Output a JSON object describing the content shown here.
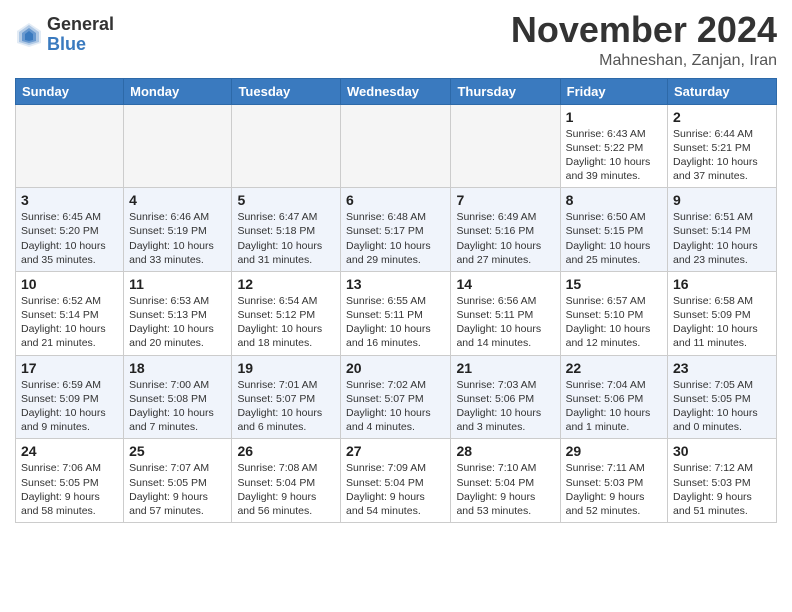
{
  "header": {
    "logo_general": "General",
    "logo_blue": "Blue",
    "month_title": "November 2024",
    "location": "Mahneshan, Zanjan, Iran"
  },
  "weekdays": [
    "Sunday",
    "Monday",
    "Tuesday",
    "Wednesday",
    "Thursday",
    "Friday",
    "Saturday"
  ],
  "weeks": [
    [
      {
        "day": "",
        "info": ""
      },
      {
        "day": "",
        "info": ""
      },
      {
        "day": "",
        "info": ""
      },
      {
        "day": "",
        "info": ""
      },
      {
        "day": "",
        "info": ""
      },
      {
        "day": "1",
        "info": "Sunrise: 6:43 AM\nSunset: 5:22 PM\nDaylight: 10 hours\nand 39 minutes."
      },
      {
        "day": "2",
        "info": "Sunrise: 6:44 AM\nSunset: 5:21 PM\nDaylight: 10 hours\nand 37 minutes."
      }
    ],
    [
      {
        "day": "3",
        "info": "Sunrise: 6:45 AM\nSunset: 5:20 PM\nDaylight: 10 hours\nand 35 minutes."
      },
      {
        "day": "4",
        "info": "Sunrise: 6:46 AM\nSunset: 5:19 PM\nDaylight: 10 hours\nand 33 minutes."
      },
      {
        "day": "5",
        "info": "Sunrise: 6:47 AM\nSunset: 5:18 PM\nDaylight: 10 hours\nand 31 minutes."
      },
      {
        "day": "6",
        "info": "Sunrise: 6:48 AM\nSunset: 5:17 PM\nDaylight: 10 hours\nand 29 minutes."
      },
      {
        "day": "7",
        "info": "Sunrise: 6:49 AM\nSunset: 5:16 PM\nDaylight: 10 hours\nand 27 minutes."
      },
      {
        "day": "8",
        "info": "Sunrise: 6:50 AM\nSunset: 5:15 PM\nDaylight: 10 hours\nand 25 minutes."
      },
      {
        "day": "9",
        "info": "Sunrise: 6:51 AM\nSunset: 5:14 PM\nDaylight: 10 hours\nand 23 minutes."
      }
    ],
    [
      {
        "day": "10",
        "info": "Sunrise: 6:52 AM\nSunset: 5:14 PM\nDaylight: 10 hours\nand 21 minutes."
      },
      {
        "day": "11",
        "info": "Sunrise: 6:53 AM\nSunset: 5:13 PM\nDaylight: 10 hours\nand 20 minutes."
      },
      {
        "day": "12",
        "info": "Sunrise: 6:54 AM\nSunset: 5:12 PM\nDaylight: 10 hours\nand 18 minutes."
      },
      {
        "day": "13",
        "info": "Sunrise: 6:55 AM\nSunset: 5:11 PM\nDaylight: 10 hours\nand 16 minutes."
      },
      {
        "day": "14",
        "info": "Sunrise: 6:56 AM\nSunset: 5:11 PM\nDaylight: 10 hours\nand 14 minutes."
      },
      {
        "day": "15",
        "info": "Sunrise: 6:57 AM\nSunset: 5:10 PM\nDaylight: 10 hours\nand 12 minutes."
      },
      {
        "day": "16",
        "info": "Sunrise: 6:58 AM\nSunset: 5:09 PM\nDaylight: 10 hours\nand 11 minutes."
      }
    ],
    [
      {
        "day": "17",
        "info": "Sunrise: 6:59 AM\nSunset: 5:09 PM\nDaylight: 10 hours\nand 9 minutes."
      },
      {
        "day": "18",
        "info": "Sunrise: 7:00 AM\nSunset: 5:08 PM\nDaylight: 10 hours\nand 7 minutes."
      },
      {
        "day": "19",
        "info": "Sunrise: 7:01 AM\nSunset: 5:07 PM\nDaylight: 10 hours\nand 6 minutes."
      },
      {
        "day": "20",
        "info": "Sunrise: 7:02 AM\nSunset: 5:07 PM\nDaylight: 10 hours\nand 4 minutes."
      },
      {
        "day": "21",
        "info": "Sunrise: 7:03 AM\nSunset: 5:06 PM\nDaylight: 10 hours\nand 3 minutes."
      },
      {
        "day": "22",
        "info": "Sunrise: 7:04 AM\nSunset: 5:06 PM\nDaylight: 10 hours\nand 1 minute."
      },
      {
        "day": "23",
        "info": "Sunrise: 7:05 AM\nSunset: 5:05 PM\nDaylight: 10 hours\nand 0 minutes."
      }
    ],
    [
      {
        "day": "24",
        "info": "Sunrise: 7:06 AM\nSunset: 5:05 PM\nDaylight: 9 hours\nand 58 minutes."
      },
      {
        "day": "25",
        "info": "Sunrise: 7:07 AM\nSunset: 5:05 PM\nDaylight: 9 hours\nand 57 minutes."
      },
      {
        "day": "26",
        "info": "Sunrise: 7:08 AM\nSunset: 5:04 PM\nDaylight: 9 hours\nand 56 minutes."
      },
      {
        "day": "27",
        "info": "Sunrise: 7:09 AM\nSunset: 5:04 PM\nDaylight: 9 hours\nand 54 minutes."
      },
      {
        "day": "28",
        "info": "Sunrise: 7:10 AM\nSunset: 5:04 PM\nDaylight: 9 hours\nand 53 minutes."
      },
      {
        "day": "29",
        "info": "Sunrise: 7:11 AM\nSunset: 5:03 PM\nDaylight: 9 hours\nand 52 minutes."
      },
      {
        "day": "30",
        "info": "Sunrise: 7:12 AM\nSunset: 5:03 PM\nDaylight: 9 hours\nand 51 minutes."
      }
    ]
  ]
}
